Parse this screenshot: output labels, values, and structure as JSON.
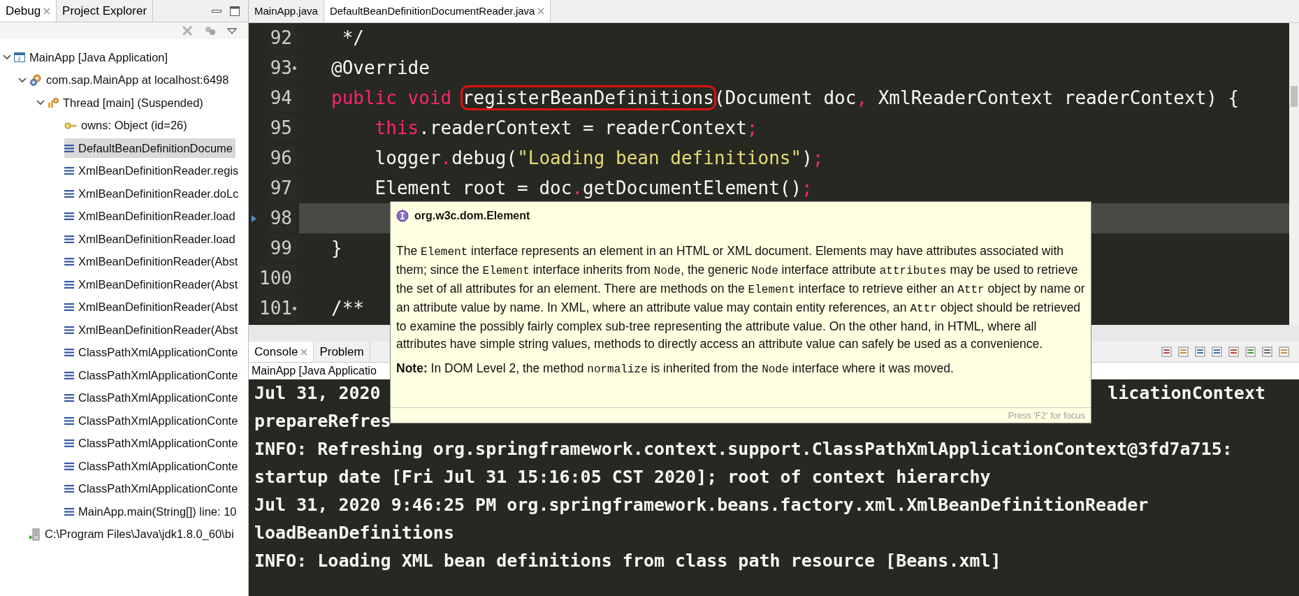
{
  "debug_view": {
    "tabs": [
      {
        "label": "Debug",
        "selected": true,
        "closable": true
      },
      {
        "label": "Project Explorer",
        "selected": false,
        "closable": false
      }
    ],
    "tree": [
      {
        "label": "MainApp [Java Application]",
        "kind": "launch",
        "expanded": true,
        "selected": false,
        "children": [
          {
            "label": "com.sap.MainApp at localhost:6498",
            "kind": "target",
            "expanded": true,
            "selected": false,
            "children": [
              {
                "label": "Thread [main] (Suspended)",
                "kind": "thread",
                "expanded": true,
                "selected": false,
                "children": [
                  {
                    "label": "owns: Object  (id=26)",
                    "kind": "monitor",
                    "selected": false
                  },
                  {
                    "label": "DefaultBeanDefinitionDocume",
                    "kind": "frame",
                    "selected": true
                  },
                  {
                    "label": "XmlBeanDefinitionReader.regis",
                    "kind": "frame",
                    "selected": false
                  },
                  {
                    "label": "XmlBeanDefinitionReader.doLc",
                    "kind": "frame",
                    "selected": false
                  },
                  {
                    "label": "XmlBeanDefinitionReader.load",
                    "kind": "frame",
                    "selected": false
                  },
                  {
                    "label": "XmlBeanDefinitionReader.load",
                    "kind": "frame",
                    "selected": false
                  },
                  {
                    "label": "XmlBeanDefinitionReader(Abst",
                    "kind": "frame",
                    "selected": false
                  },
                  {
                    "label": "XmlBeanDefinitionReader(Abst",
                    "kind": "frame",
                    "selected": false
                  },
                  {
                    "label": "XmlBeanDefinitionReader(Abst",
                    "kind": "frame",
                    "selected": false
                  },
                  {
                    "label": "XmlBeanDefinitionReader(Abst",
                    "kind": "frame",
                    "selected": false
                  },
                  {
                    "label": "ClassPathXmlApplicationConte",
                    "kind": "frame",
                    "selected": false
                  },
                  {
                    "label": "ClassPathXmlApplicationConte",
                    "kind": "frame",
                    "selected": false
                  },
                  {
                    "label": "ClassPathXmlApplicationConte",
                    "kind": "frame",
                    "selected": false
                  },
                  {
                    "label": "ClassPathXmlApplicationConte",
                    "kind": "frame",
                    "selected": false
                  },
                  {
                    "label": "ClassPathXmlApplicationConte",
                    "kind": "frame",
                    "selected": false
                  },
                  {
                    "label": "ClassPathXmlApplicationConte",
                    "kind": "frame",
                    "selected": false
                  },
                  {
                    "label": "ClassPathXmlApplicationConte",
                    "kind": "frame",
                    "selected": false
                  },
                  {
                    "label": "MainApp.main(String[]) line: 10",
                    "kind": "frame",
                    "selected": false
                  }
                ]
              }
            ]
          },
          {
            "label": "C:\\Program Files\\Java\\jdk1.8.0_60\\bi",
            "kind": "process",
            "selected": false
          }
        ]
      }
    ]
  },
  "editor": {
    "tabs": [
      {
        "label": "MainApp.java",
        "selected": false,
        "closable": false
      },
      {
        "label": "DefaultBeanDefinitionDocumentReader.java",
        "selected": true,
        "closable": true
      }
    ],
    "lines": [
      {
        "number": "92",
        "marker": false,
        "current": false,
        "segments": [
          {
            "text": " */",
            "kind": "plain"
          }
        ]
      },
      {
        "number": "93",
        "marker": true,
        "current": false,
        "segments": [
          {
            "text": "@Override",
            "kind": "plain"
          }
        ]
      },
      {
        "number": "94",
        "marker": false,
        "current": false,
        "segments": [
          {
            "text": "public void ",
            "kind": "keyword"
          },
          {
            "text": "registerBeanDefinitions",
            "kind": "boxed"
          },
          {
            "text": "(Document doc",
            "kind": "plain"
          },
          {
            "text": ",",
            "kind": "punct"
          },
          {
            "text": " XmlReaderContext readerContext) {",
            "kind": "plain"
          }
        ]
      },
      {
        "number": "95",
        "marker": false,
        "current": false,
        "segments": [
          {
            "text": "    this",
            "kind": "keyword"
          },
          {
            "text": ".readerContext = readerContext",
            "kind": "plain"
          },
          {
            "text": ";",
            "kind": "punct"
          }
        ]
      },
      {
        "number": "96",
        "marker": false,
        "current": false,
        "segments": [
          {
            "text": "    logger",
            "kind": "plain"
          },
          {
            "text": ".",
            "kind": "punct"
          },
          {
            "text": "debug(",
            "kind": "plain"
          },
          {
            "text": "\"Loading bean definitions\"",
            "kind": "string"
          },
          {
            "text": ")",
            "kind": "plain"
          },
          {
            "text": ";",
            "kind": "punct"
          }
        ]
      },
      {
        "number": "97",
        "marker": false,
        "current": false,
        "segments": [
          {
            "text": "    Element root = doc",
            "kind": "plain"
          },
          {
            "text": ".",
            "kind": "punct"
          },
          {
            "text": "getDocumentElement()",
            "kind": "plain"
          },
          {
            "text": ";",
            "kind": "punct"
          }
        ]
      },
      {
        "number": "98",
        "marker": false,
        "current": true
      },
      {
        "number": "99",
        "marker": false,
        "current": false,
        "segments": [
          {
            "text": "}",
            "kind": "plain"
          }
        ]
      },
      {
        "number": "100",
        "marker": false,
        "current": false
      },
      {
        "number": "101",
        "marker": true,
        "current": false,
        "segments": [
          {
            "text": "/**",
            "kind": "plain"
          }
        ]
      }
    ]
  },
  "hover": {
    "title": "org.w3c.dom.Element",
    "paragraphs": [
      [
        {
          "text": "The ",
          "kind": "plain"
        },
        {
          "text": "Element",
          "kind": "code"
        },
        {
          "text": " interface represents an element in an HTML or XML document. Elements may have attributes associated with them; since the ",
          "kind": "plain"
        },
        {
          "text": "Element",
          "kind": "code"
        },
        {
          "text": " interface inherits from ",
          "kind": "plain"
        },
        {
          "text": "Node",
          "kind": "code"
        },
        {
          "text": ", the generic ",
          "kind": "plain"
        },
        {
          "text": "Node",
          "kind": "code"
        },
        {
          "text": " interface attribute ",
          "kind": "plain"
        },
        {
          "text": "attributes",
          "kind": "code"
        },
        {
          "text": " may be used to retrieve the set of all attributes for an element. There are methods on the ",
          "kind": "plain"
        },
        {
          "text": "Element",
          "kind": "code"
        },
        {
          "text": " interface to retrieve either an ",
          "kind": "plain"
        },
        {
          "text": "Attr",
          "kind": "code"
        },
        {
          "text": " object by name or an attribute value by name. In XML, where an attribute value may contain entity references, an ",
          "kind": "plain"
        },
        {
          "text": "Attr",
          "kind": "code"
        },
        {
          "text": " object should be retrieved to examine the possibly fairly complex sub-tree representing the attribute value. On the other hand, in HTML, where all attributes have simple string values, methods to directly access an attribute value can safely be used as a convenience.",
          "kind": "plain"
        }
      ],
      [
        {
          "text": "Note:",
          "kind": "bold"
        },
        {
          "text": " In DOM Level 2, the method ",
          "kind": "plain"
        },
        {
          "text": "normalize",
          "kind": "code"
        },
        {
          "text": " is inherited from the ",
          "kind": "plain"
        },
        {
          "text": "Node",
          "kind": "code"
        },
        {
          "text": " interface where it was moved.",
          "kind": "plain"
        }
      ]
    ],
    "footer": "Press 'F2' for focus"
  },
  "console_view": {
    "tabs": [
      {
        "label": "Console",
        "selected": true,
        "closable": true
      },
      {
        "label": "Problem",
        "selected": false,
        "closable": false
      }
    ],
    "process": "MainApp [Java Applicatio",
    "first_line": {
      "left": "Jul 31, 2020",
      "right": "licationContext"
    },
    "lines": [
      "prepareRefres",
      "INFO: Refreshing org.springframework.context.support.ClassPathXmlApplicationContext@3fd7a715:",
      "startup date [Fri Jul 31 15:16:05 CST 2020]; root of context hierarchy",
      "Jul 31, 2020 9:46:25 PM org.springframework.beans.factory.xml.XmlBeanDefinitionReader",
      "loadBeanDefinitions",
      "INFO: Loading XML bean definitions from class path resource [Beans.xml]"
    ]
  }
}
